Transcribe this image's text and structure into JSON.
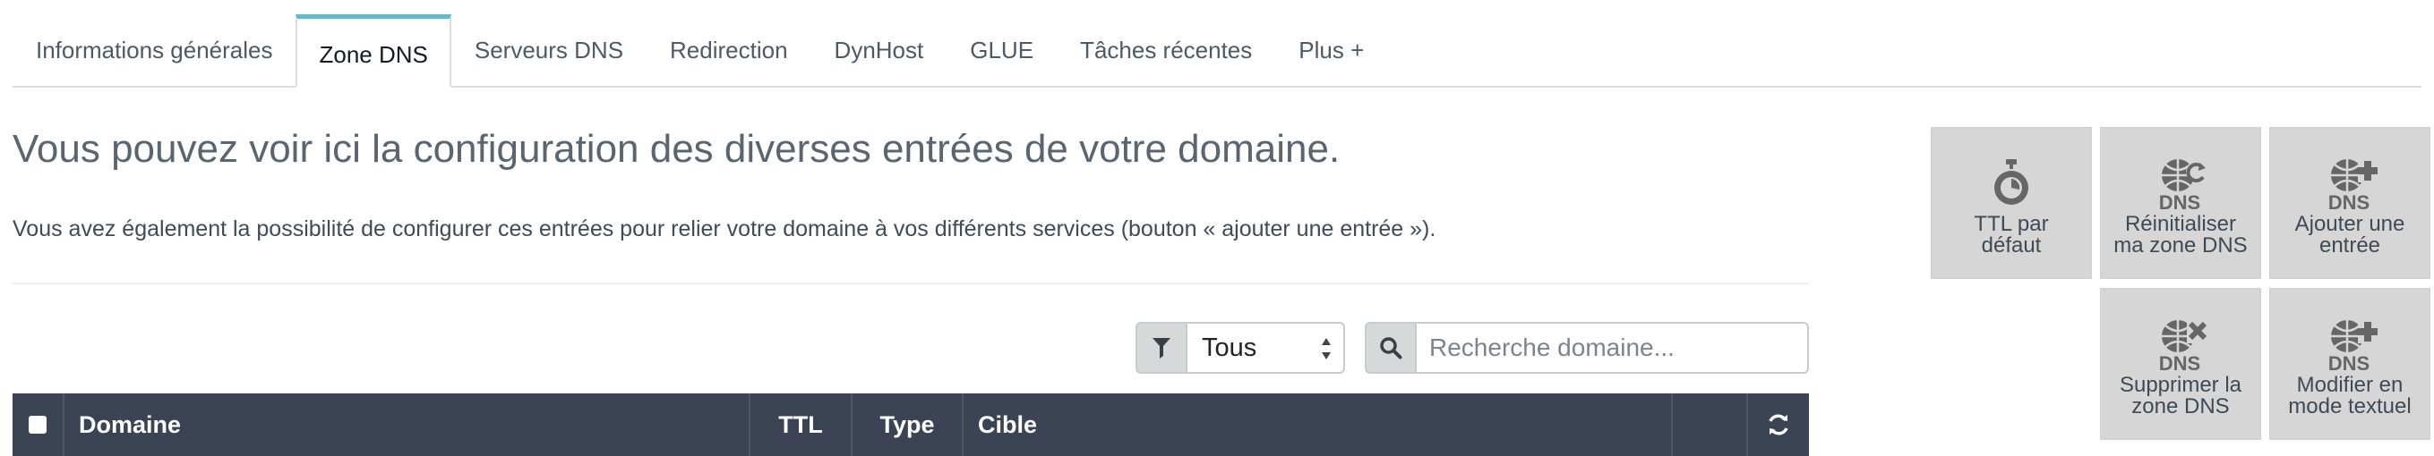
{
  "tabs": [
    {
      "label": "Informations générales",
      "active": false
    },
    {
      "label": "Zone DNS",
      "active": true
    },
    {
      "label": "Serveurs DNS",
      "active": false
    },
    {
      "label": "Redirection",
      "active": false
    },
    {
      "label": "DynHost",
      "active": false
    },
    {
      "label": "GLUE",
      "active": false
    },
    {
      "label": "Tâches récentes",
      "active": false
    },
    {
      "label": "Plus +",
      "active": false
    }
  ],
  "main": {
    "headline": "Vous pouvez voir ici la configuration des diverses entrées de votre domaine.",
    "description": "Vous avez également la possibilité de configurer ces entrées pour relier votre domaine à vos différents services (bouton « ajouter une entrée »)."
  },
  "filter": {
    "icon": "filter-icon",
    "selected": "Tous"
  },
  "search": {
    "icon": "search-icon",
    "placeholder": "Recherche domaine...",
    "value": ""
  },
  "table": {
    "columns": {
      "domain": "Domaine",
      "ttl": "TTL",
      "type": "Type",
      "target": "Cible"
    },
    "refresh_icon": "refresh-icon"
  },
  "actions": {
    "ttl_default": {
      "line1": "TTL par",
      "line2": "défaut",
      "icon": "stopwatch-icon"
    },
    "reset_zone": {
      "line1": "Réinitialiser",
      "line2": "ma zone DNS",
      "icon": "dns-reset-icon",
      "icon_text": "DNS"
    },
    "add_entry": {
      "line1": "Ajouter une",
      "line2": "entrée",
      "icon": "dns-add-icon",
      "icon_text": "DNS"
    },
    "delete_zone": {
      "line1": "Supprimer la",
      "line2": "zone DNS",
      "icon": "dns-delete-icon",
      "icon_text": "DNS"
    },
    "edit_text": {
      "line1": "Modifier en",
      "line2": "mode textuel",
      "icon": "dns-edit-icon",
      "icon_text": "DNS"
    }
  },
  "colors": {
    "tab_accent": "#6ab8c6",
    "table_header_bg": "#3b4354",
    "tile_bg": "#d6d6d6",
    "icon_gray": "#666666"
  }
}
